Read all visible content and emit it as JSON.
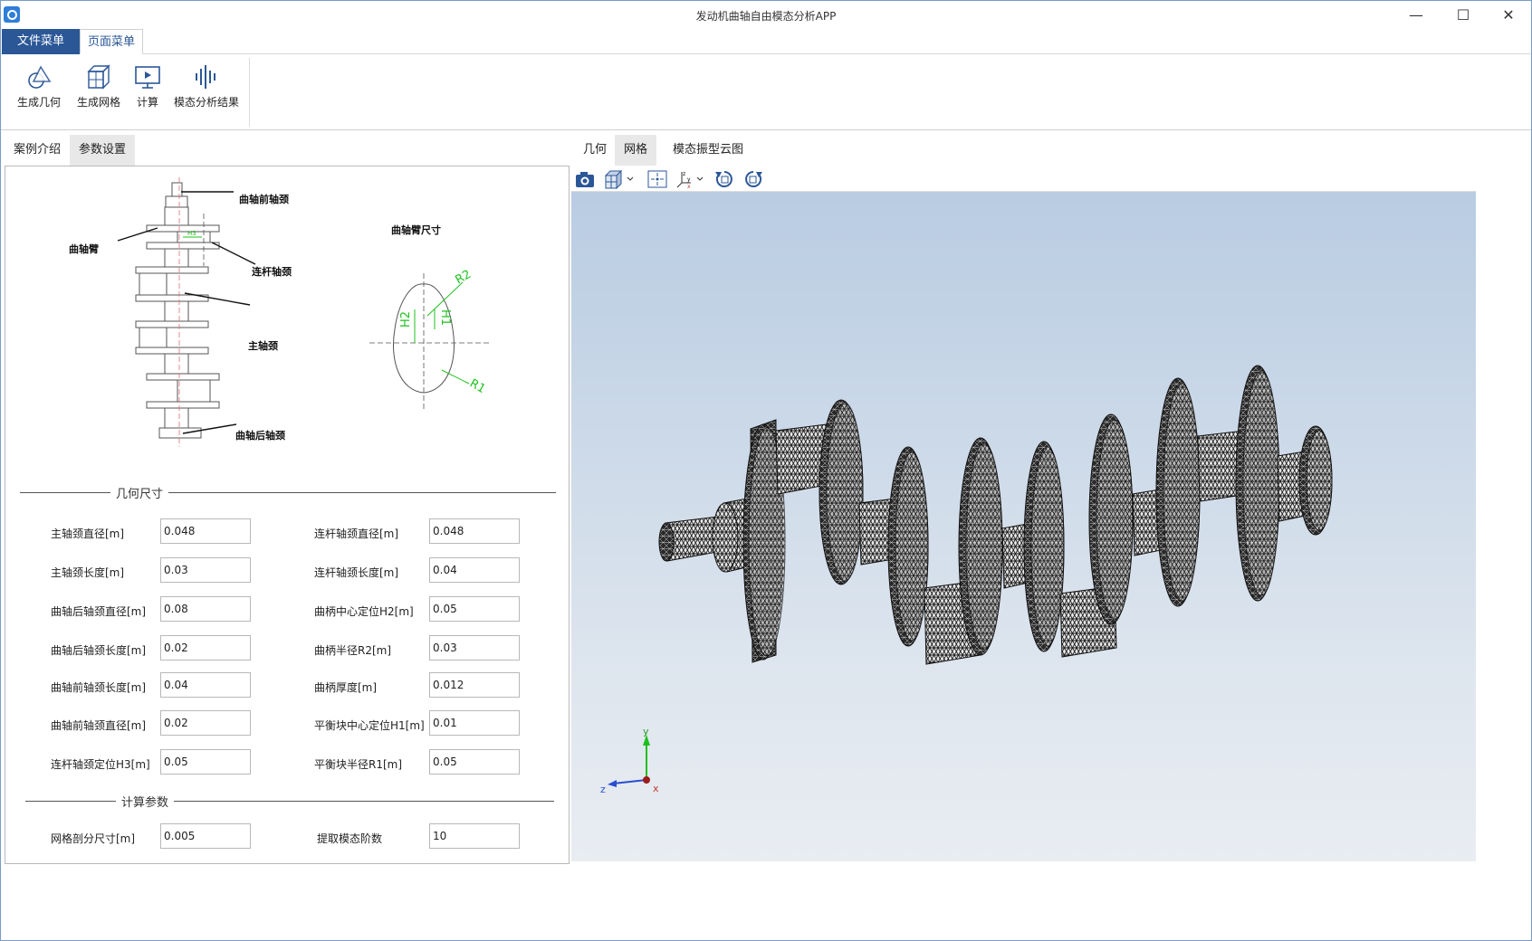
{
  "window": {
    "title": "发动机曲轴自由模态分析APP",
    "minimize_icon": "minimize-icon",
    "maximize_icon": "maximize-icon",
    "close_icon": "close-icon"
  },
  "ribbon": {
    "tabs": [
      {
        "label": "文件菜单"
      },
      {
        "label": "页面菜单"
      }
    ],
    "buttons": [
      {
        "label": "生成几何",
        "icon": "geometry-icon"
      },
      {
        "label": "生成网格",
        "icon": "mesh-icon"
      },
      {
        "label": "计算",
        "icon": "compute-icon"
      },
      {
        "label": "模态分析结果",
        "icon": "modal-result-icon"
      }
    ]
  },
  "left_panel": {
    "tabs": [
      {
        "label": "案例介绍"
      },
      {
        "label": "参数设置"
      }
    ],
    "diagram": {
      "labels": {
        "front": "曲轴前轴颈",
        "arm": "曲轴臂",
        "rod": "连杆轴颈",
        "main": "主轴颈",
        "rear": "曲轴后轴颈",
        "arm_size": "曲轴臂尺寸",
        "r2": "R2",
        "r1": "R1",
        "h1": "H1",
        "h2": "H2",
        "h3": "H3"
      }
    },
    "geometry_section": "几何尺寸",
    "params_left": [
      {
        "label": "主轴颈直径[m]",
        "value": "0.048"
      },
      {
        "label": "主轴颈长度[m]",
        "value": "0.03"
      },
      {
        "label": "曲轴后轴颈直径[m]",
        "value": "0.08"
      },
      {
        "label": "曲轴后轴颈长度[m]",
        "value": "0.02"
      },
      {
        "label": "曲轴前轴颈长度[m]",
        "value": "0.04"
      },
      {
        "label": "曲轴前轴颈直径[m]",
        "value": "0.02"
      },
      {
        "label": "连杆轴颈定位H3[m]",
        "value": "0.05"
      }
    ],
    "params_right": [
      {
        "label": "连杆轴颈直径[m]",
        "value": "0.048"
      },
      {
        "label": "连杆轴颈长度[m]",
        "value": "0.04"
      },
      {
        "label": "曲柄中心定位H2[m]",
        "value": "0.05"
      },
      {
        "label": "曲柄半径R2[m]",
        "value": "0.03"
      },
      {
        "label": "曲柄厚度[m]",
        "value": "0.012"
      },
      {
        "label": "平衡块中心定位H1[m]",
        "value": "0.01"
      },
      {
        "label": "平衡块半径R1[m]",
        "value": "0.05"
      }
    ],
    "calc_section": "计算参数",
    "calc_params": [
      {
        "label": "网格剖分尺寸[m]",
        "value": "0.005"
      },
      {
        "label": "提取模态阶数",
        "value": "10"
      }
    ]
  },
  "right_panel": {
    "tabs": [
      {
        "label": "几何"
      },
      {
        "label": "网格"
      },
      {
        "label": "模态振型云图"
      }
    ],
    "toolbar": [
      "camera-icon",
      "view-cube-icon",
      "fit-view-icon",
      "axis-orient-icon",
      "rotate-ccw-icon",
      "rotate-cw-icon"
    ],
    "triad": {
      "x": "x",
      "y": "y",
      "z": "z"
    }
  }
}
